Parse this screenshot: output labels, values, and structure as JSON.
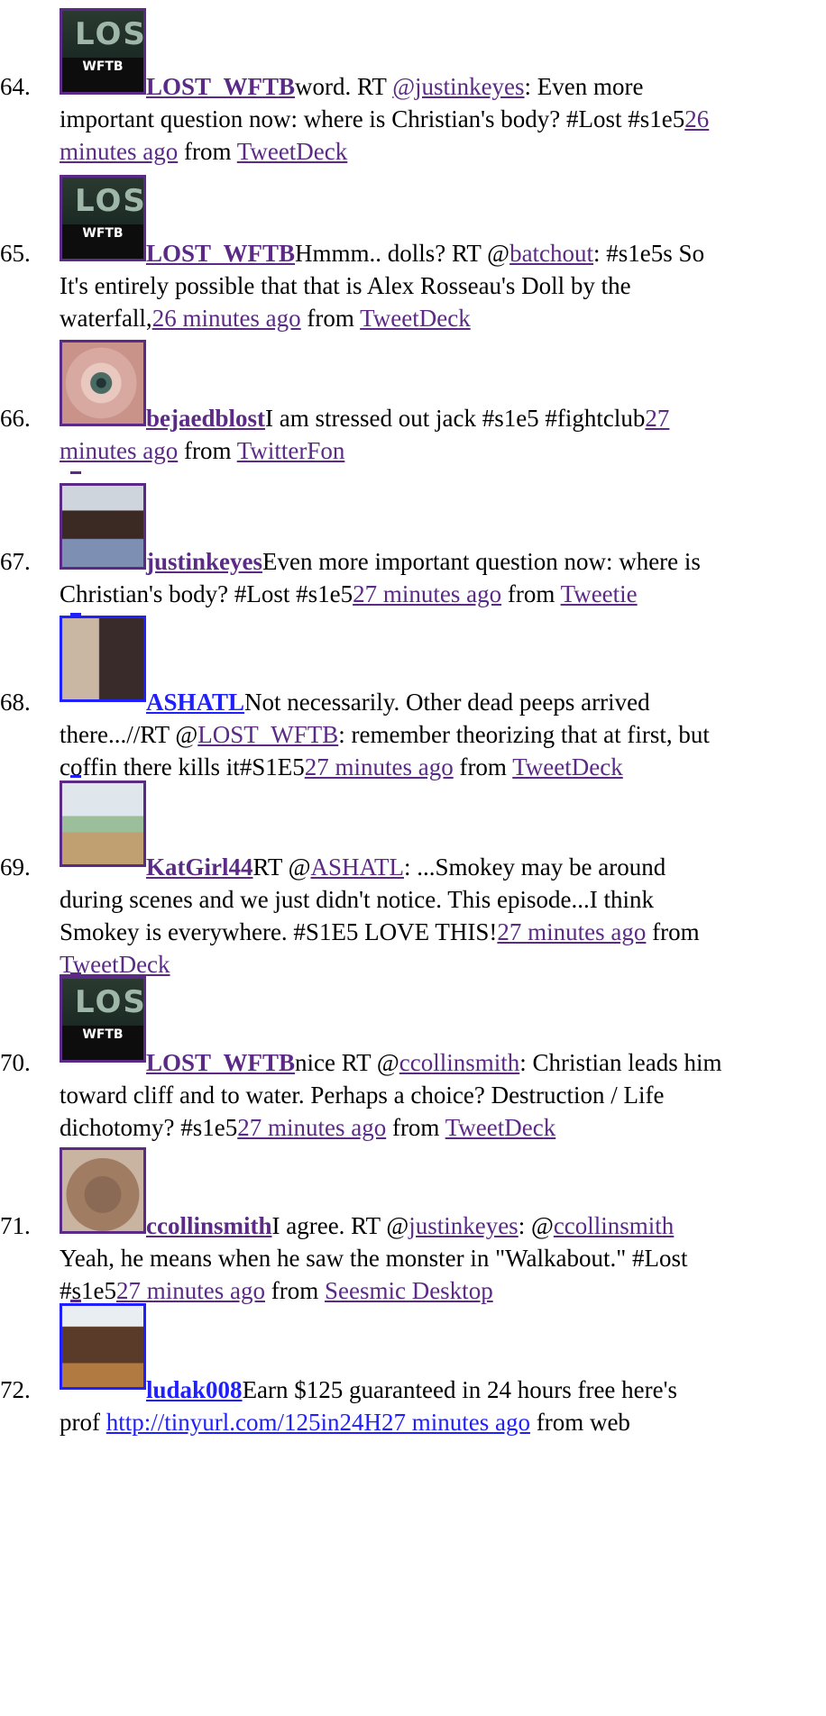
{
  "tweets": [
    {
      "num": "64.",
      "avatar": "lost-wftb-avatar",
      "avatar_title": "LOST",
      "avatar_sub": "WFTB",
      "user": "LOST_WFTB",
      "line1": "word. RT ",
      "mention1": "@justinkeyes",
      "line1b": ": Even more",
      "line2": "important question now: where is Christian's body? #Lost #s1e5",
      "time_a": "26",
      "time_b": "minutes ago",
      "from": " from ",
      "source": "TweetDeck"
    },
    {
      "num": "65.",
      "avatar": "lost-wftb-avatar",
      "avatar_title": "LOST",
      "avatar_sub": "WFTB",
      "user": "LOST_WFTB",
      "line1": "Hmmm.. dolls? RT @",
      "mention1": "batchout",
      "line1b": ": #s1e5s So",
      "line2": "It's entirely possible that that is Alex Rosseau's Doll by the",
      "line3": "waterfall,",
      "time": "26 minutes ago",
      "from": " from ",
      "source": "TweetDeck"
    },
    {
      "num": "66.",
      "avatar": "eye-avatar",
      "user": "bejaedblost",
      "line1": "I am stressed out jack #s1e5 #fightclub",
      "time_a": "27",
      "time_b": "minutes ago",
      "from": " from ",
      "source": "TwitterFon"
    },
    {
      "num": "67.",
      "avatar": "man-avatar",
      "user": "justinkeyes",
      "line1": "Even more important question now: where is",
      "line2": "Christian's body? #Lost #s1e5",
      "time": "27 minutes ago",
      "from": " from ",
      "source": "Tweetie"
    },
    {
      "num": "68.",
      "avatar": "couple-avatar",
      "user": "ASHATL",
      "line1": "Not necessarily. Other dead peeps arrived",
      "line2a": "there...//RT @",
      "mention2": "LOST_WFTB",
      "line2b": ": remember theorizing that at first, but",
      "line3": "coffin there kills it#S1E5",
      "time": "27 minutes ago",
      "from": " from ",
      "source": "TweetDeck"
    },
    {
      "num": "69.",
      "avatar": "hearts-avatar",
      "user": "KatGirl44",
      "line1": "RT @",
      "mention1": "ASHATL",
      "line1b": ": ...Smokey may be around",
      "line2": "during scenes and we just didn't notice. This episode...I think",
      "line3": "Smokey is everywhere. #S1E5 LOVE THIS!",
      "time": "27 minutes ago",
      "from": " from",
      "source": "TweetDeck"
    },
    {
      "num": "70.",
      "avatar": "lost-wftb-avatar",
      "avatar_title": "LOST",
      "avatar_sub": "WFTB",
      "user": "LOST_WFTB",
      "line1": "nice RT @",
      "mention1": "ccollinsmith",
      "line1b": ": Christian leads him",
      "line2": "toward cliff and to water. Perhaps a choice? Destruction / Life",
      "line3": "dichotomy? #s1e5",
      "time": "27 minutes ago",
      "from": " from ",
      "source": "TweetDeck"
    },
    {
      "num": "71.",
      "avatar": "hair-avatar",
      "user": "ccollinsmith",
      "line1": "I agree. RT @",
      "mention1": "justinkeyes",
      "line1b": ": @",
      "mention1b": "ccollinsmith",
      "line2": "Yeah, he means when he saw the monster in \"Walkabout.\" #Lost",
      "line3": "#s1e5",
      "time": "27 minutes ago",
      "from": " from ",
      "source": "Seesmic Desktop"
    },
    {
      "num": "72.",
      "avatar": "guy-avatar",
      "user": "ludak008",
      "line1": "Earn $125 guaranteed in 24 hours free here's",
      "line2a": "prof ",
      "url": "http://tinyurl.com/125in24H",
      "time": "27 minutes ago",
      "from": " from web"
    }
  ]
}
